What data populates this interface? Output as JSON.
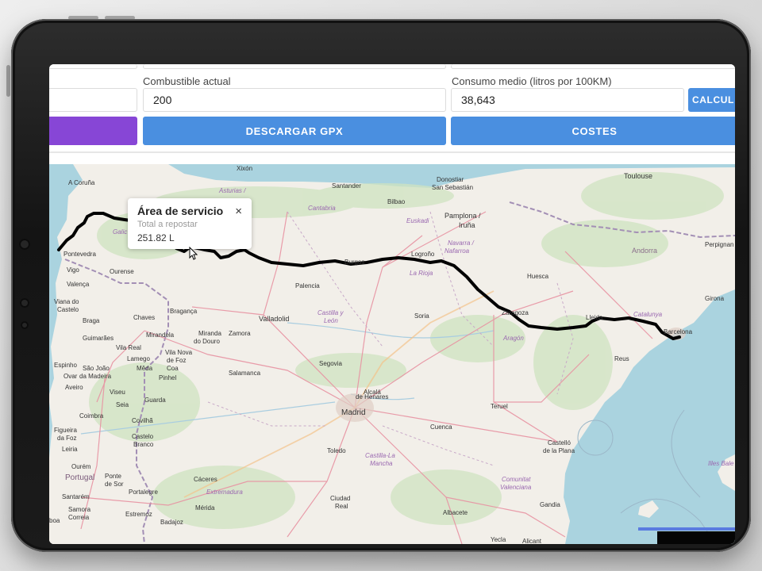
{
  "form": {
    "fuel_label": "Combustible actual",
    "fuel_value": "200",
    "consumption_label": "Consumo medio (litros por 100KM)",
    "consumption_value": "38,643",
    "calculate_label": "CALCUL",
    "download_gpx_label": "DESCARGAR GPX",
    "costs_label": "COSTES"
  },
  "colors": {
    "primary_button": "#4a8fe0",
    "purple_button": "#8746d6",
    "route": "#000000"
  },
  "popup": {
    "title": "Área de servicio",
    "close_glyph": "×",
    "subtitle": "Total a repostar",
    "value": "251.82 L"
  },
  "map": {
    "labels": {
      "xixon": "Xixón",
      "acoruna": "A Coruña",
      "asturias": "Asturias /",
      "santander": "Santander",
      "donostia": "Donostiar",
      "sansebastian": "San Sebastián",
      "toulouse": "Toulouse",
      "cantabria": "Cantabria",
      "bilbao": "Bilbao",
      "pamplona": "Pamplona /",
      "iruna": "Iruña",
      "euskadi": "Euskadi",
      "galicia": "Galic",
      "navarra": "Navarra /",
      "nafarroa": "Nafarroa",
      "andorra": "Andorra",
      "perpignan": "Perpignan",
      "pontevedra": "Pontevedra",
      "vigo": "Vigo",
      "ourense": "Ourense",
      "burgos": "Burgos",
      "logrono": "Logroño",
      "larioja": "La Rioja",
      "huesca": "Huesca",
      "girona": "Girona",
      "valenca": "Valença",
      "palencia": "Palencia",
      "vianadocastelo": "Viana do",
      "castelo": "Castelo",
      "braga": "Braga",
      "chaves": "Chaves",
      "braganca": "Bragança",
      "valladolid": "Valladolid",
      "castillaleon1": "Castilla y",
      "castillaleon2": "León",
      "soria": "Soria",
      "zaragoza": "Zaragoza",
      "lleida": "Lleida",
      "catalunya": "Catalunya",
      "barcelona": "Barcelona",
      "guimaraes": "Guimarães",
      "mirandela": "Mirandela",
      "miranda1": "Miranda",
      "miranda2": "do Douro",
      "zamora": "Zamora",
      "aragon": "Aragón",
      "vilareal": "Vila Real",
      "lamego": "Lamego",
      "vilanova1": "Vila Nova",
      "vilanova2": "de Foz",
      "vilanova3": "Coa",
      "reus": "Reus",
      "espinho": "Espinho",
      "saojoao1": "São João",
      "saojoao2": "da Madeira",
      "meda": "Mêda",
      "segovia": "Segovia",
      "ovar": "Ovar",
      "pinhel": "Pinhel",
      "salamanca": "Salamanca",
      "aveiro": "Aveiro",
      "alcala1": "Alcalá",
      "alcala2": "de Henares",
      "viseu": "Viseu",
      "guarda": "Guarda",
      "seia": "Seia",
      "madrid": "Madrid",
      "coimbra": "Coimbra",
      "teruel": "Teruel",
      "covilha": "Covilhã",
      "figueira1": "Figueira",
      "figueira2": "da Foz",
      "cuenca": "Cuenca",
      "castelobranco1": "Castelo",
      "castelobranco2": "Branco",
      "leiria": "Leiria",
      "toledo": "Toledo",
      "castellon1": "Castelló",
      "castellon2": "de la Plana",
      "castillamancha1": "Castilla-La",
      "castillamancha2": "Mancha",
      "ourem": "Ourém",
      "portugal": "Portugal",
      "pontedesor1": "Ponte",
      "pontedesor2": "de Sor",
      "caceres": "Cáceres",
      "illesbalears": "Illes Bale",
      "comunitat1": "Comunitat",
      "comunitat2": "Valenciana",
      "extremadura": "Extremadura",
      "santarem": "Santarém",
      "portalegre": "Portalegre",
      "ciudadreal1": "Ciudad",
      "ciudadreal2": "Real",
      "gandia": "Gandia",
      "samora1": "Samora",
      "samora2": "Correia",
      "estremoz": "Estremoz",
      "merida": "Mérida",
      "albacete": "Albacete",
      "lisboa": "boa",
      "badajoz": "Badajoz",
      "yecla": "Yecla",
      "alicante": "Alicant"
    }
  }
}
